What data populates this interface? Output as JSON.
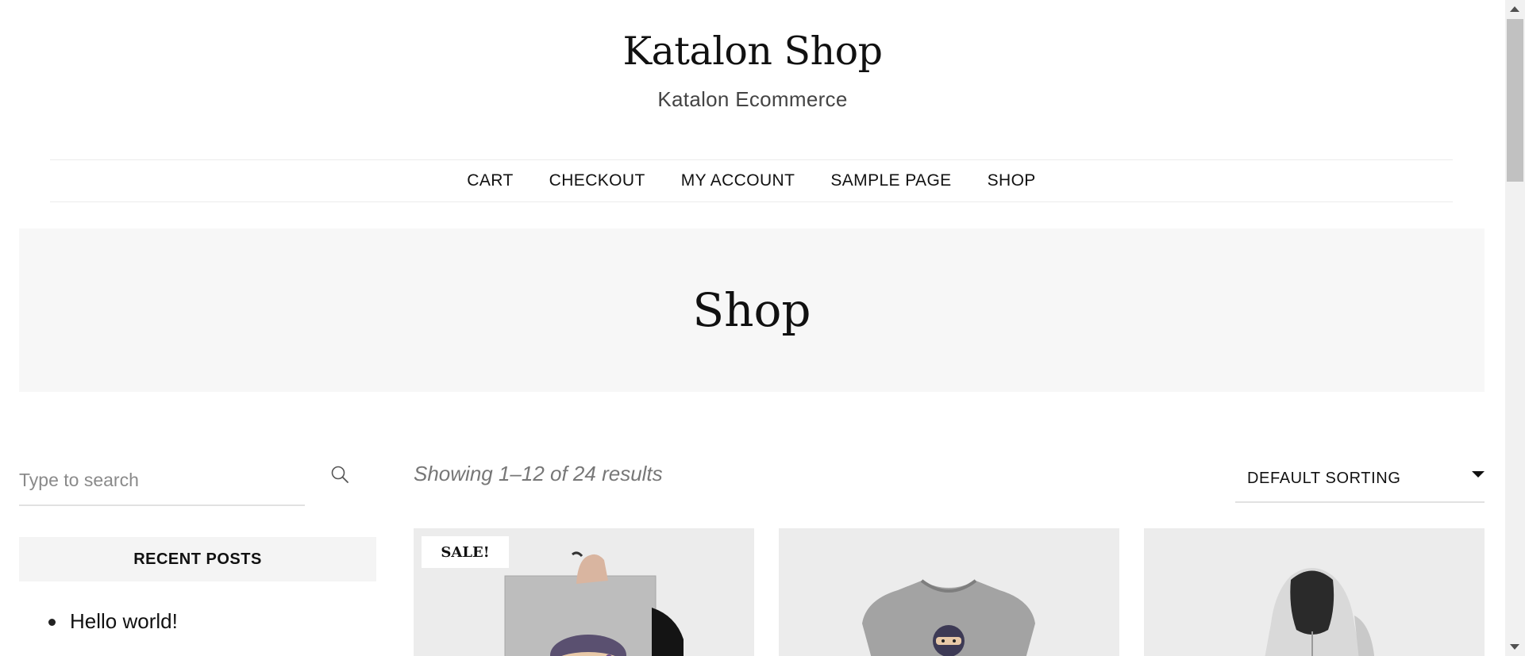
{
  "header": {
    "site_title": "Katalon Shop",
    "tagline": "Katalon Ecommerce"
  },
  "nav": {
    "items": [
      {
        "label": "CART"
      },
      {
        "label": "CHECKOUT"
      },
      {
        "label": "MY ACCOUNT"
      },
      {
        "label": "SAMPLE PAGE"
      },
      {
        "label": "SHOP"
      }
    ]
  },
  "banner": {
    "title": "Shop"
  },
  "sidebar": {
    "search": {
      "placeholder": "Type to search",
      "value": "",
      "icon": "search-icon"
    },
    "recent_posts": {
      "title": "RECENT POSTS",
      "items": [
        {
          "label": "Hello world!"
        }
      ]
    }
  },
  "results": {
    "count_text": "Showing 1–12 of 24 results",
    "sorting": {
      "selected": "DEFAULT SORTING",
      "icon": "chevron-down-icon"
    }
  },
  "products": [
    {
      "badge": "SALE!",
      "image": "poster-ninja"
    },
    {
      "badge": "",
      "image": "tshirt-ninja"
    },
    {
      "badge": "",
      "image": "hoodie"
    }
  ],
  "colors": {
    "text": "#111111",
    "muted": "#777777",
    "banner_bg": "#f7f7f7",
    "product_bg": "#ececec",
    "divider": "#e1e1e1"
  }
}
